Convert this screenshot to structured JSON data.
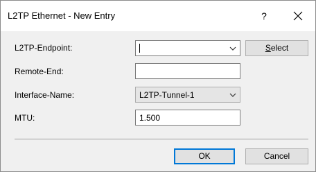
{
  "window": {
    "title": "L2TP Ethernet - New Entry",
    "help_label": "?",
    "close_icon": "close-icon"
  },
  "form": {
    "endpoint": {
      "label": "L2TP-Endpoint:",
      "value": ""
    },
    "select_button": {
      "label_underlined": "S",
      "label_rest": "elect"
    },
    "remote_end": {
      "label": "Remote-End:",
      "value": ""
    },
    "interface_name": {
      "label": "Interface-Name:",
      "value": "L2TP-Tunnel-1"
    },
    "mtu": {
      "label": "MTU:",
      "value": "1.500"
    }
  },
  "buttons": {
    "ok": "OK",
    "cancel": "Cancel"
  },
  "colors": {
    "default_button_border": "#0078d7",
    "button_bg": "#e1e1e1",
    "dialog_bg": "#f0f0f0"
  }
}
